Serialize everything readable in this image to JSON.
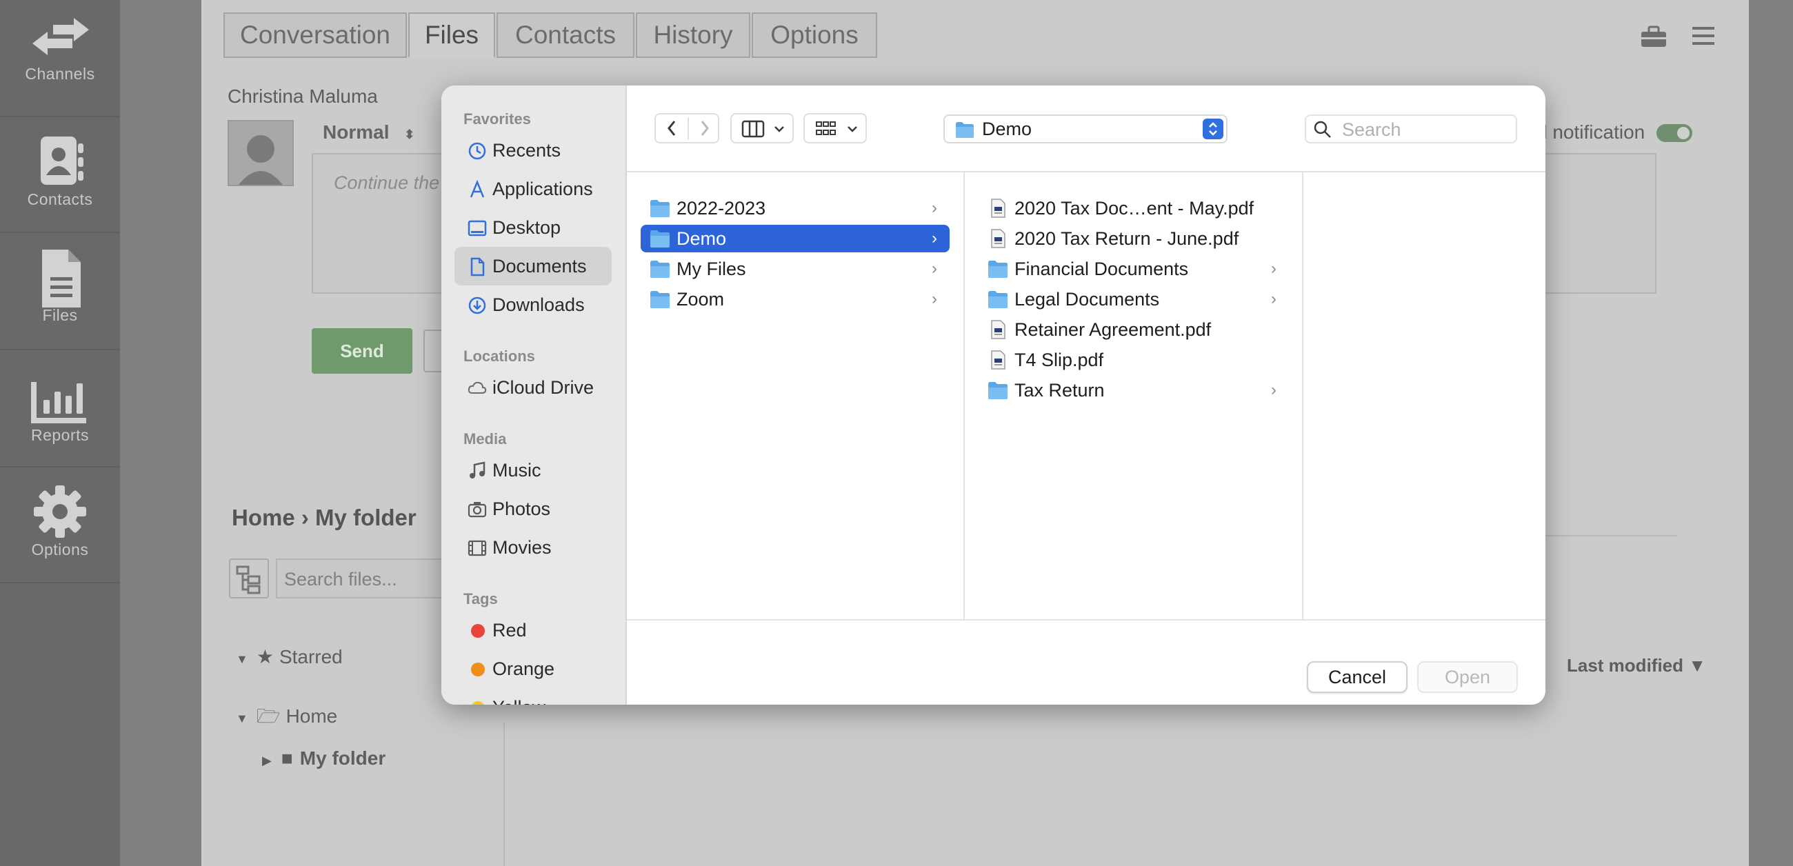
{
  "rail": {
    "items": [
      {
        "label": "Channels",
        "icon": "arrows-icon"
      },
      {
        "label": "Contacts",
        "icon": "contact-card-icon"
      },
      {
        "label": "Files",
        "icon": "file-icon"
      },
      {
        "label": "Reports",
        "icon": "bar-chart-icon"
      },
      {
        "label": "Options",
        "icon": "gear-icon"
      }
    ]
  },
  "tabs": [
    "Conversation",
    "Files",
    "Contacts",
    "History",
    "Options"
  ],
  "active_tab": "Files",
  "contact_name": "Christina Maluma",
  "priority": "Normal",
  "message_placeholder": "Continue the",
  "notification_label": "d notification",
  "send_label": "Send",
  "breadcrumb": {
    "home": "Home",
    "sep": "›",
    "folder": "My folder"
  },
  "search_files_placeholder": "Search files...",
  "tree": {
    "starred": "Starred",
    "home": "Home",
    "my_folder": "My folder"
  },
  "sort_label": "Last modified ▼",
  "dialog": {
    "sidebar": {
      "favorites_title": "Favorites",
      "favorites": [
        {
          "label": "Recents",
          "icon": "clock-icon"
        },
        {
          "label": "Applications",
          "icon": "applications-icon"
        },
        {
          "label": "Desktop",
          "icon": "desktop-icon"
        },
        {
          "label": "Documents",
          "icon": "document-icon",
          "selected": true
        },
        {
          "label": "Downloads",
          "icon": "download-icon"
        }
      ],
      "locations_title": "Locations",
      "locations": [
        {
          "label": "iCloud Drive",
          "icon": "cloud-icon"
        }
      ],
      "media_title": "Media",
      "media": [
        {
          "label": "Music",
          "icon": "music-note-icon"
        },
        {
          "label": "Photos",
          "icon": "camera-icon"
        },
        {
          "label": "Movies",
          "icon": "film-icon"
        }
      ],
      "tags_title": "Tags",
      "tags": [
        {
          "label": "Red",
          "color": "#e8453c"
        },
        {
          "label": "Orange",
          "color": "#f08c1a"
        },
        {
          "label": "Yellow",
          "color": "#f5c518"
        }
      ]
    },
    "location": "Demo",
    "search_placeholder": "Search",
    "column1": [
      {
        "label": "2022-2023",
        "kind": "folder"
      },
      {
        "label": "Demo",
        "kind": "folder",
        "selected": true
      },
      {
        "label": "My Files",
        "kind": "folder"
      },
      {
        "label": "Zoom",
        "kind": "folder"
      }
    ],
    "column2": [
      {
        "label": "2020 Tax Doc…ent - May.pdf",
        "kind": "pdf"
      },
      {
        "label": "2020 Tax Return - June.pdf",
        "kind": "pdf"
      },
      {
        "label": "Financial Documents",
        "kind": "folder"
      },
      {
        "label": "Legal Documents",
        "kind": "folder"
      },
      {
        "label": "Retainer Agreement.pdf",
        "kind": "pdf"
      },
      {
        "label": "T4 Slip.pdf",
        "kind": "pdf"
      },
      {
        "label": "Tax Return",
        "kind": "folder"
      }
    ],
    "cancel_label": "Cancel",
    "open_label": "Open"
  }
}
